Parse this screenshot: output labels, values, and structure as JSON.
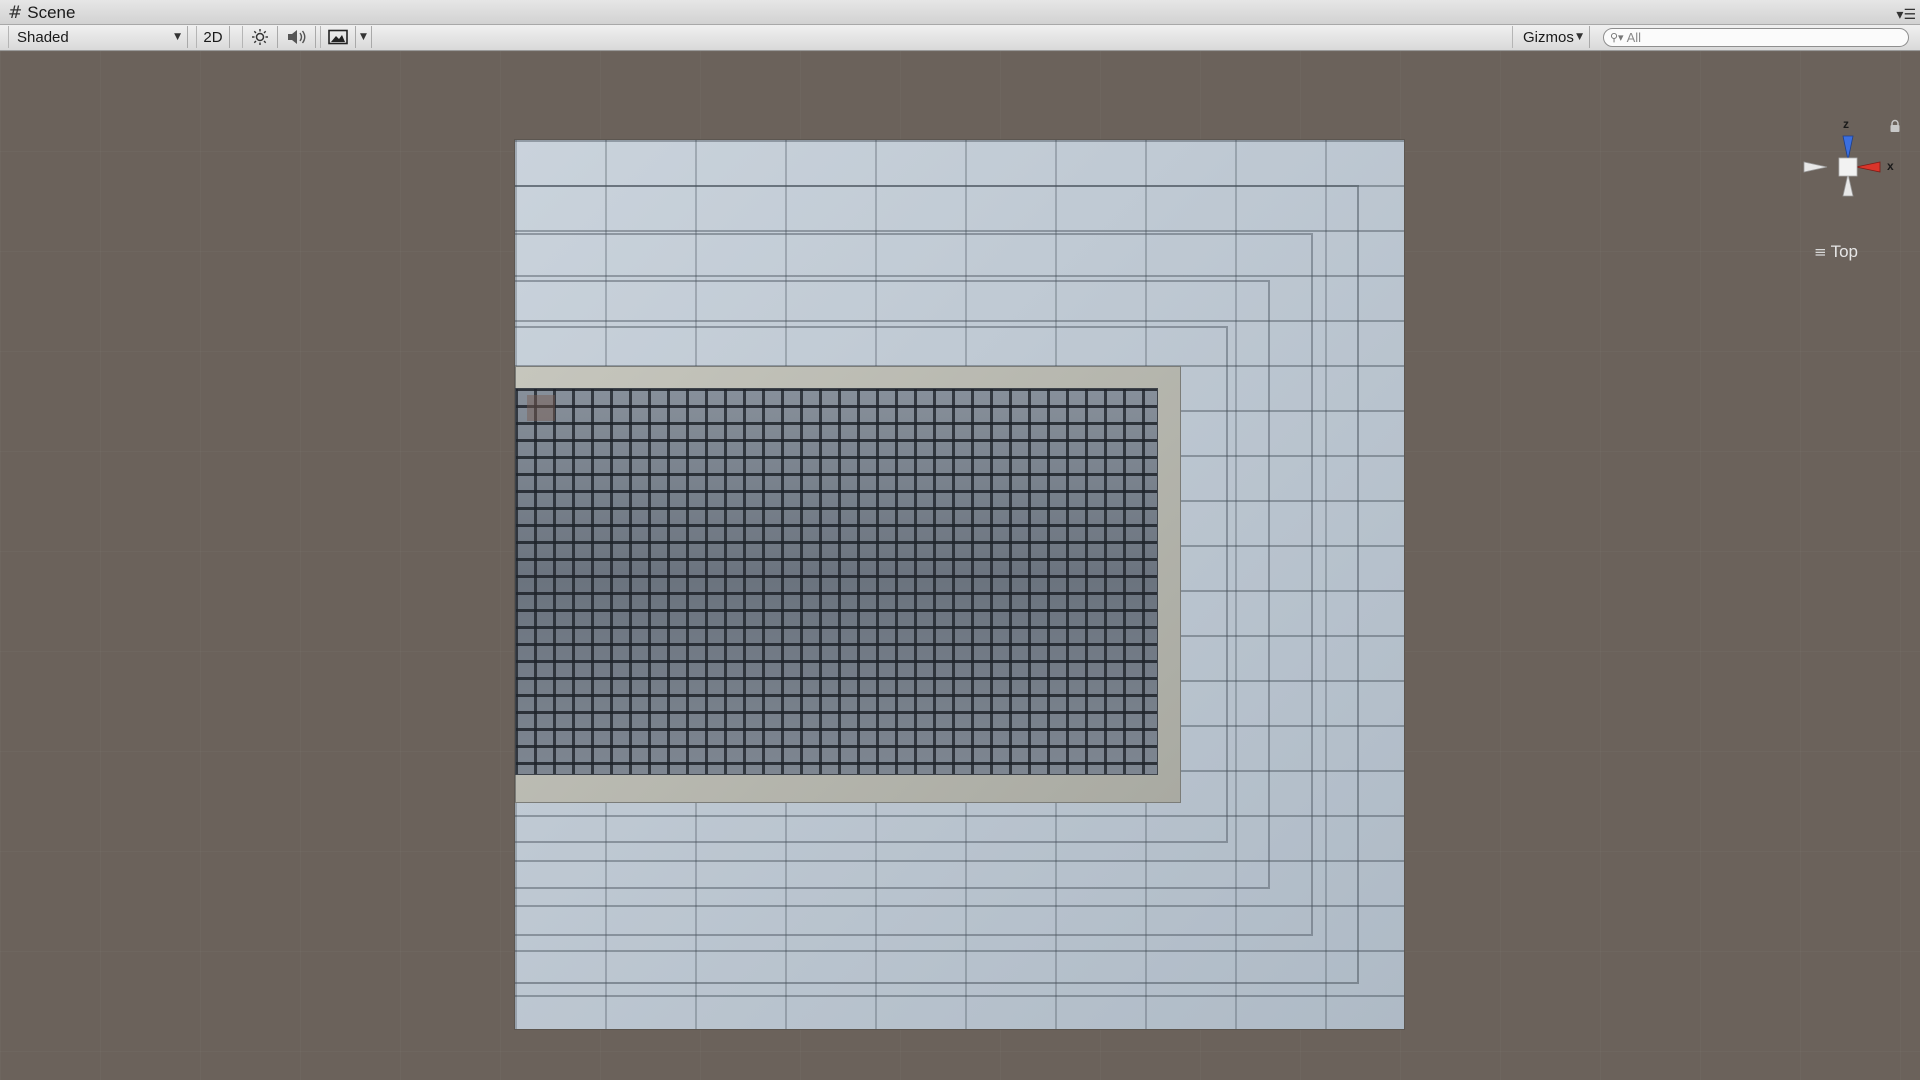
{
  "window": {
    "tab_title": "Scene",
    "tab_icon": "hash-grid-icon",
    "tab_menu_icon": "panel-menu-icon"
  },
  "toolbar": {
    "draw_mode": "Shaded",
    "mode_2d_label": "2D",
    "lighting_icon": "sun-icon",
    "audio_icon": "speaker-icon",
    "effects_icon": "image-icon",
    "gizmos_label": "Gizmos",
    "search_placeholder": "All"
  },
  "scene_gizmo": {
    "axis_z": "z",
    "axis_x": "x",
    "view_name": "Top",
    "colors": {
      "z_axis": "#3b6fe0",
      "x_axis": "#d9352a",
      "neutral_axis": "#e8e8e8"
    }
  },
  "colors": {
    "viewport_bg": "#6b625b",
    "tile_light": "#b8c4d0",
    "cobble": "#6f7782",
    "curb": "#c6c6bd"
  }
}
